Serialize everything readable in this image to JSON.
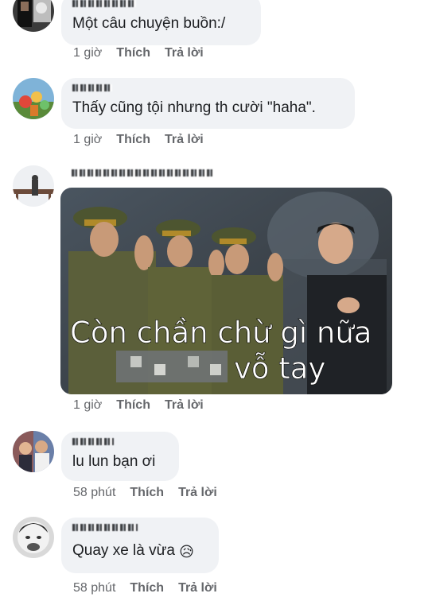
{
  "comments": [
    {
      "text": "Một câu chuyện buồn:/",
      "time": "1 giờ",
      "like_label": "Thích",
      "reply_label": "Trả lời"
    },
    {
      "text": "Thấy cũng tội nhưng th cười \"haha\".",
      "time": "1 giờ",
      "like_label": "Thích",
      "reply_label": "Trả lời"
    },
    {
      "image_caption_line1": "Còn chần chừ gì nữa",
      "image_caption_line2": "vỗ tay",
      "time": "1 giờ",
      "like_label": "Thích",
      "reply_label": "Trả lời"
    },
    {
      "text": "lu  lun bạn ơi",
      "time": "58 phút",
      "like_label": "Thích",
      "reply_label": "Trả lời"
    },
    {
      "text": "Quay xe là vừa",
      "emoji": "😥",
      "time": "58 phút",
      "like_label": "Thích",
      "reply_label": "Trả lời"
    }
  ],
  "colors": {
    "bubble": "#f0f2f5",
    "meta": "#65676b",
    "text": "#1c1e21"
  }
}
